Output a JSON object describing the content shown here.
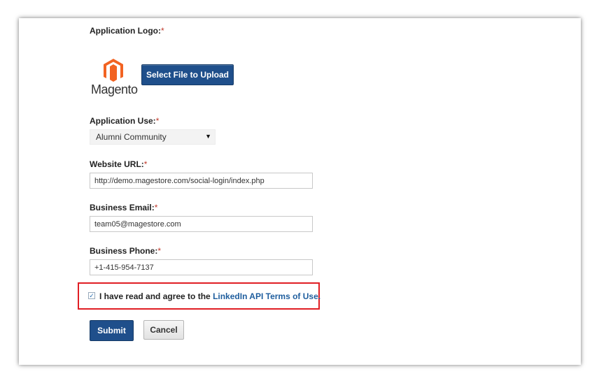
{
  "form": {
    "logo_label": "Application Logo:",
    "use_label": "Application Use:",
    "url_label": "Website URL:",
    "email_label": "Business Email:",
    "phone_label": "Business Phone:",
    "required_mark": "*"
  },
  "logo": {
    "brand_name": "Magento",
    "icon": "magento-logo",
    "color": "#f26322"
  },
  "upload": {
    "button_label": "Select File to Upload"
  },
  "application_use": {
    "selected": "Alumni Community",
    "caret": "▼"
  },
  "fields": {
    "website_url": "http://demo.magestore.com/social-login/index.php",
    "business_email": "team05@magestore.com",
    "business_phone": "+1-415-954-7137"
  },
  "agreement": {
    "checked": true,
    "check_glyph": "✓",
    "text": "I have read and agree to the ",
    "link_text": "LinkedIn API Terms of Use."
  },
  "actions": {
    "submit_label": "Submit",
    "cancel_label": "Cancel"
  },
  "colors": {
    "primary": "#1f4f8b",
    "highlight": "#e01e24",
    "link": "#1f5e9e"
  }
}
